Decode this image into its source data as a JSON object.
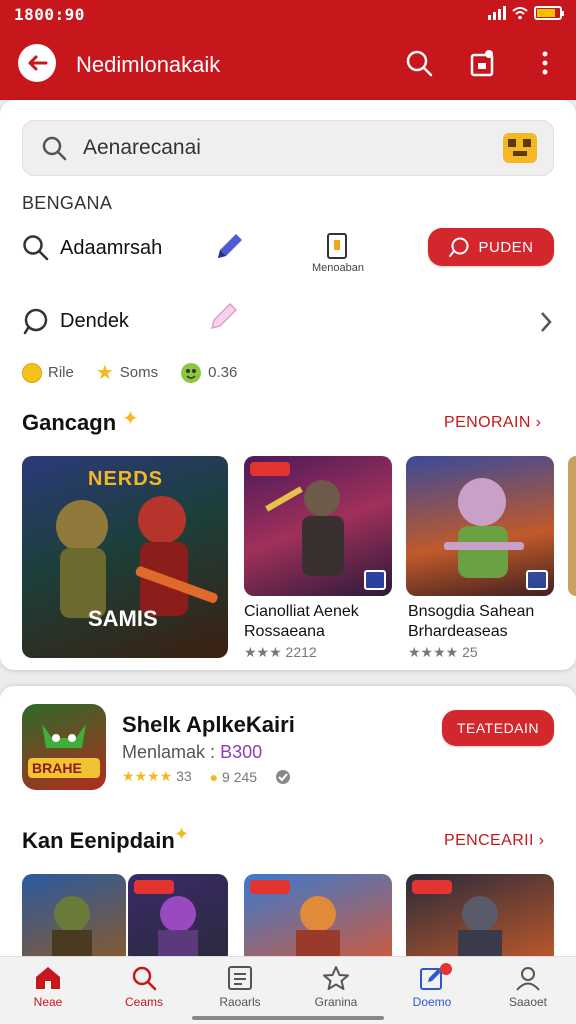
{
  "status_bar": {
    "time": "1800:90",
    "battery_level": 0.8
  },
  "app_bar": {
    "title": "Nedimlonakaik",
    "brand_color": "#c8161d",
    "icons": [
      "back-arrow-icon",
      "search-icon",
      "share-icon",
      "more-vertical-icon"
    ]
  },
  "search": {
    "value": "Aenarecanai",
    "placeholder": ""
  },
  "section_label": "BENGANA",
  "quick_actions": {
    "primary": {
      "label": "Adaamrsah",
      "icon": "search-icon",
      "pencil_icon": "pen-icon"
    },
    "mini_caption": "Menoaban",
    "pill_button": "PUDEN",
    "secondary": {
      "label": "Dendek",
      "icon": "chat-icon"
    }
  },
  "meta": {
    "coin": "Rile",
    "star": "Soms",
    "rating": "0.36"
  },
  "section1": {
    "title": "Gancagn",
    "see_all": "PENORAIN",
    "cards": [
      {
        "overlay_title": "NERDS",
        "overlay_label": "SAMIS"
      },
      {
        "title_line1": "Cianolliat Aenek",
        "title_line2": "Rossaeana",
        "rating": "★★★ 2212"
      },
      {
        "title_line1": "Bnsogdia Sahean",
        "title_line2": "Brhardeaseas",
        "rating": "★★★★ 25"
      }
    ]
  },
  "featured": {
    "name": "Shelk AplkeKairi",
    "subtitle": "Menlamak :",
    "price": "B300",
    "stars": "★★★★",
    "rating_count": "33",
    "downloads": "9 245",
    "button": "TEATEDAIN",
    "icon_text": "BRAHE"
  },
  "section2": {
    "title": "Kan Eenipdain",
    "see_all": "PENCEARII"
  },
  "bottom_nav": [
    {
      "label": "Neae",
      "icon": "home-icon",
      "active": true
    },
    {
      "label": "Ceams",
      "icon": "search-icon",
      "active": true
    },
    {
      "label": "Raoarls",
      "icon": "list-icon",
      "active": false
    },
    {
      "label": "Granina",
      "icon": "star-icon",
      "active": false
    },
    {
      "label": "Doemo",
      "icon": "edit-icon",
      "active": false,
      "badge": true
    },
    {
      "label": "Saaoet",
      "icon": "profile-icon",
      "active": false
    }
  ]
}
